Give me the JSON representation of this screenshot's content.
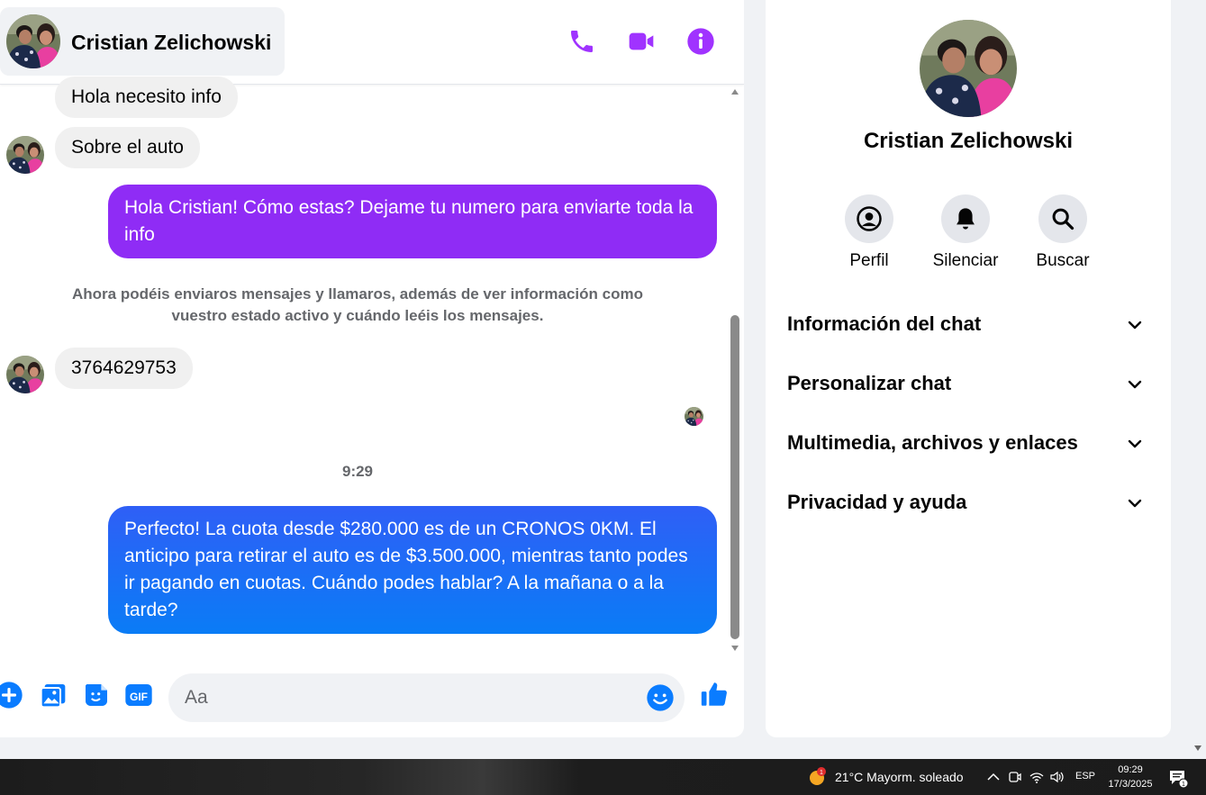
{
  "chat": {
    "contact_name": "Cristian Zelichowski",
    "header_icons": [
      "phone-icon",
      "video-icon",
      "info-icon"
    ],
    "messages": {
      "in_1": "Hola necesito info",
      "in_2": "Sobre el auto",
      "out_1": "Hola Cristian! Cómo estas? Dejame tu numero para enviarte toda la info",
      "system_notice": "Ahora podéis enviaros mensajes y llamaros, además de ver información como vuestro estado activo y cuándo leéis los mensajes.",
      "in_3": "3764629753",
      "timestamp": "9:29",
      "out_2": "Perfecto! La cuota desde $280.000 es de un CRONOS 0KM. El anticipo para retirar el auto es de $3.500.000, mientras tanto podes ir pagando en cuotas. Cuándo podes hablar? A la mañana o a la tarde?"
    },
    "composer": {
      "placeholder": "Aa",
      "icons": [
        "plus-icon",
        "image-icon",
        "sticker-icon",
        "gif-icon",
        "emoji-icon",
        "like-icon"
      ]
    }
  },
  "info_panel": {
    "name": "Cristian Zelichowski",
    "actions": {
      "profile": "Perfil",
      "mute": "Silenciar",
      "search": "Buscar"
    },
    "sections": {
      "chat_info": "Información del chat",
      "customize": "Personalizar chat",
      "media": "Multimedia, archivos y enlaces",
      "privacy": "Privacidad y ayuda"
    }
  },
  "taskbar": {
    "weather_badge": "1",
    "weather": "21°C  Mayorm. soleado",
    "language": "ESP",
    "time": "09:29",
    "date": "17/3/2025",
    "notification_count": "1"
  },
  "colors": {
    "accent_purple": "#a033ff",
    "bubble_purple": "#8f2cf5",
    "bubble_blue": "#1877f2",
    "messenger_blue": "#0a7cff"
  }
}
